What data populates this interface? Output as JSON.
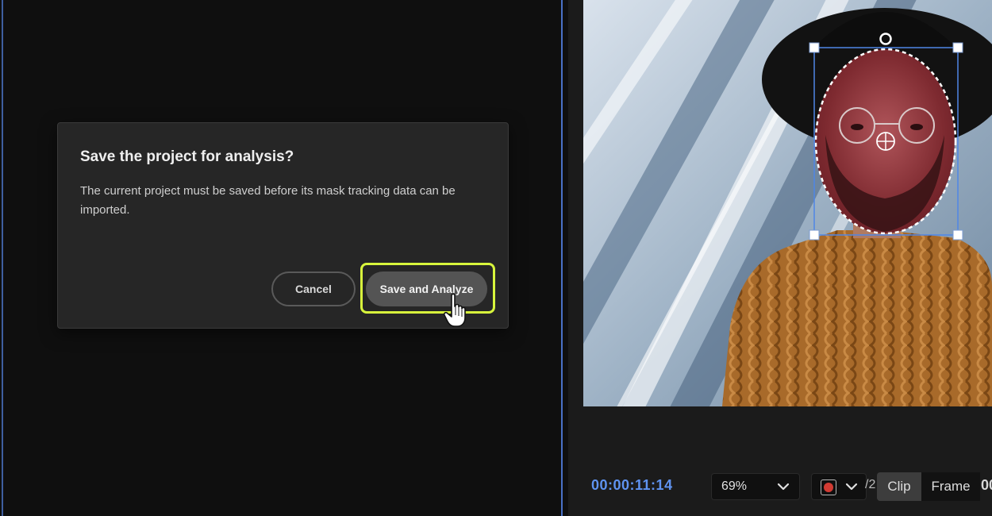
{
  "dialog": {
    "title": "Save the project for analysis?",
    "body": "The current project must be saved before its mask tracking data can be imported.",
    "cancel_label": "Cancel",
    "save_label": "Save and Analyze"
  },
  "viewer": {
    "timecode": "00:00:11:14",
    "zoom": "69%",
    "fraction_partial": "/2",
    "segment_clip": "Clip",
    "segment_frame": "Frame",
    "trailing_partial": "00"
  },
  "colors": {
    "accent_blue": "#5f93f0",
    "highlight": "#d8f53c",
    "record_red": "#d23b33"
  }
}
